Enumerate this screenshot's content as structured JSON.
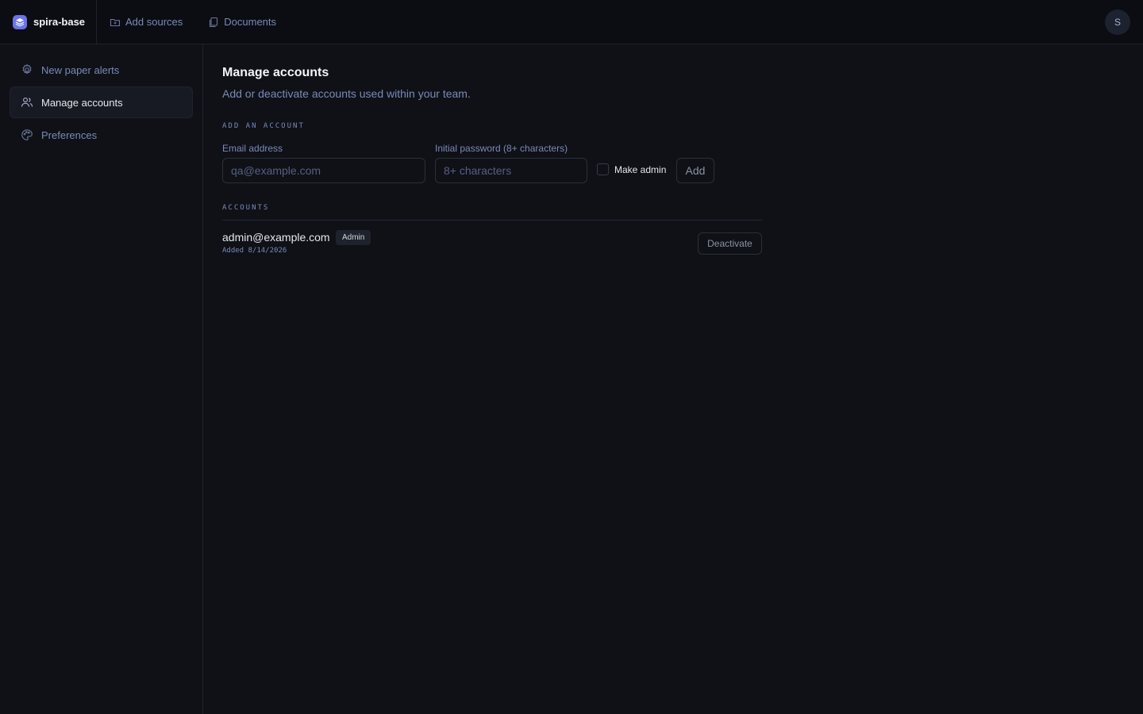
{
  "app": {
    "name": "spira-base"
  },
  "topnav": {
    "items": [
      {
        "label": "Add sources",
        "icon": "folder-add-icon"
      },
      {
        "label": "Documents",
        "icon": "documents-icon"
      }
    ]
  },
  "user": {
    "initial": "S"
  },
  "sidebar": {
    "items": [
      {
        "label": "New paper alerts",
        "icon": "gear-icon",
        "active": false
      },
      {
        "label": "Manage accounts",
        "icon": "users-icon",
        "active": true
      },
      {
        "label": "Preferences",
        "icon": "palette-icon",
        "active": false
      }
    ]
  },
  "main": {
    "title": "Manage accounts",
    "subtitle": "Add or deactivate accounts used within your team.",
    "add_section": {
      "label": "ADD AN ACCOUNT",
      "email_label": "Email address",
      "email_placeholder": "qa@example.com",
      "password_label": "Initial password (8+ characters)",
      "password_placeholder": "8+ characters",
      "make_admin_label": "Make admin",
      "make_admin_checked": false,
      "add_button": "Add"
    },
    "accounts_section": {
      "label": "ACCOUNTS",
      "accounts": [
        {
          "email": "admin@example.com",
          "badge": "Admin",
          "added": "Added 8/14/2026",
          "action": "Deactivate"
        }
      ]
    }
  },
  "colors": {
    "background": "#0f1117",
    "topbar": "#0b0d13",
    "accent": "#6d73e8",
    "muted_text": "#7a8ab8",
    "border": "#2a2f3c"
  }
}
